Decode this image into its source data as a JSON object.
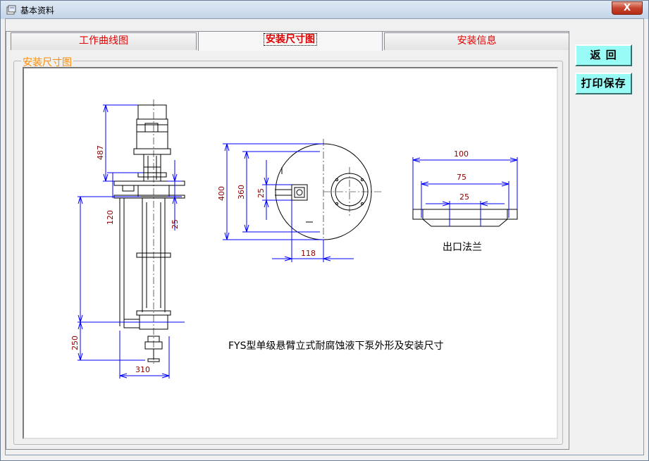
{
  "window": {
    "title": "基本资料",
    "close_symbol": "X"
  },
  "tabs": [
    {
      "label": "工作曲线图",
      "active": false
    },
    {
      "label": "安装尺寸图",
      "active": true
    },
    {
      "label": "安装信息",
      "active": false
    }
  ],
  "group": {
    "label": "安装尺寸图"
  },
  "buttons": {
    "back": "返  回",
    "print_save": "打印保存"
  },
  "drawing": {
    "dims": {
      "d487": "487",
      "d120": "120",
      "d25a": "25",
      "d250": "250",
      "d310": "310",
      "d400": "400",
      "d360": "360",
      "d25b": "25",
      "d118": "118",
      "d100": "100",
      "d75": "75",
      "d25c": "25"
    },
    "flange_caption": "出口法兰",
    "caption": "FYS型单级悬臂立式耐腐蚀液下泵外形及安装尺寸"
  },
  "colors": {
    "dimension": "#0000ff",
    "dim_text": "#8b0000",
    "outline": "#000000",
    "tab_text": "#e10000",
    "group_label": "#ff8c00",
    "button_bg": "#98fbf5"
  }
}
